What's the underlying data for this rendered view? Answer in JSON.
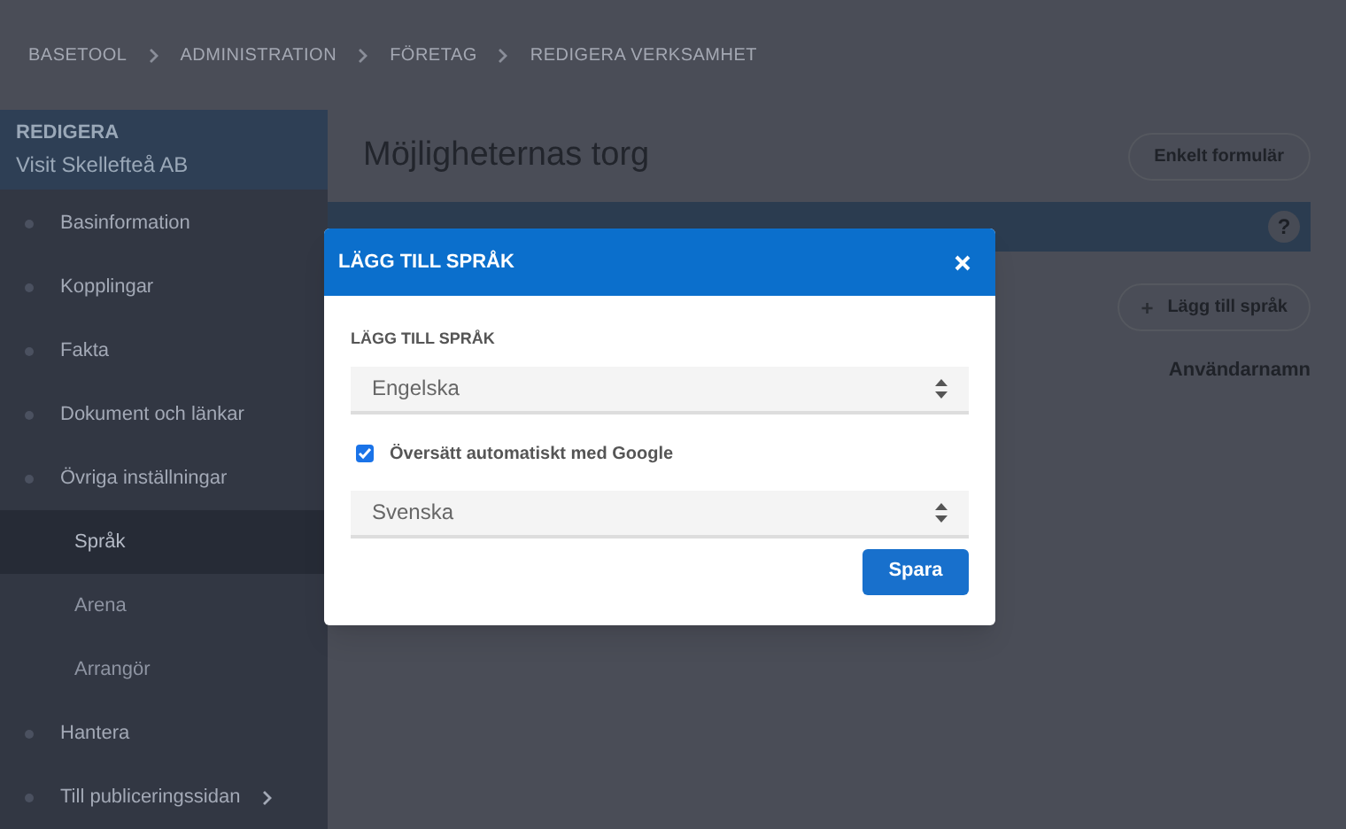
{
  "breadcrumb": [
    "BASETOOL",
    "ADMINISTRATION",
    "FÖRETAG",
    "REDIGERA VERKSAMHET"
  ],
  "sidebar": {
    "heading": "REDIGERA",
    "subtitle": "Visit Skellefteå AB",
    "items": [
      {
        "label": "Basinformation"
      },
      {
        "label": "Kopplingar"
      },
      {
        "label": "Fakta"
      },
      {
        "label": "Dokument och länkar"
      },
      {
        "label": "Övriga inställningar",
        "children": [
          {
            "label": "Språk",
            "selected": true
          },
          {
            "label": "Arena",
            "selected": false
          },
          {
            "label": "Arrangör",
            "selected": false
          }
        ]
      },
      {
        "label": "Hantera"
      },
      {
        "label": "Till publiceringssidan",
        "kind": "link"
      }
    ]
  },
  "page": {
    "title": "Möjligheternas torg",
    "form_button": "Enkelt formulär",
    "help": "?",
    "add_icon": "+",
    "add_button": "Lägg till språk",
    "columns": [
      "Användarnamn"
    ]
  },
  "dialog": {
    "title": "LÄGG TILL SPRÅK",
    "field_label": "LÄGG TILL SPRÅK",
    "language": "Engelska",
    "auto_translate": {
      "label": "Översätt automatiskt med Google",
      "checked": true
    },
    "source_language": "Svenska",
    "save": "Spara"
  }
}
